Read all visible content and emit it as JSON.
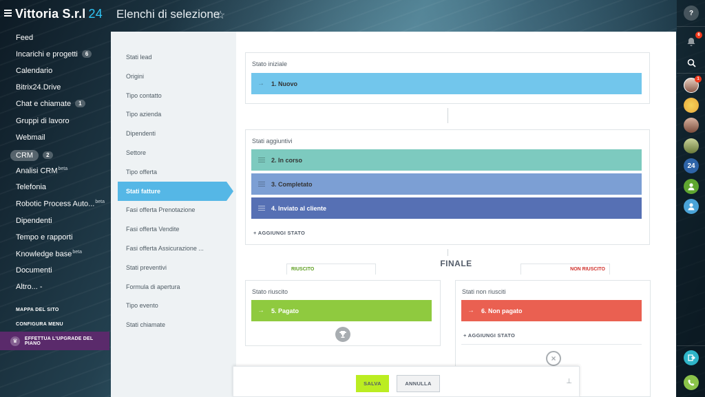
{
  "header": {
    "brand_name": "Vittoria S.r.l",
    "brand_suffix": "24",
    "page_title": "Elenchi di selezione",
    "star_glyph": "☆"
  },
  "left_menu": {
    "items": [
      {
        "label": "Feed"
      },
      {
        "label": "Incarichi e progetti",
        "badge": "6"
      },
      {
        "label": "Calendario"
      },
      {
        "label": "Bitrix24.Drive"
      },
      {
        "label": "Chat e chiamate",
        "badge": "1"
      },
      {
        "label": "Gruppi di lavoro"
      },
      {
        "label": "Webmail"
      },
      {
        "label": "CRM",
        "badge": "2",
        "active": true
      },
      {
        "label": "Analisi CRM",
        "sup": "beta"
      },
      {
        "label": "Telefonia"
      },
      {
        "label": "Robotic Process Auto...",
        "sup": "beta"
      },
      {
        "label": "Dipendenti"
      },
      {
        "label": "Tempo e rapporti"
      },
      {
        "label": "Knowledge base",
        "sup": "beta"
      },
      {
        "label": "Documenti"
      },
      {
        "label": "Altro... -"
      }
    ],
    "site_map": "MAPPA DEL SITO",
    "configure_menu": "CONFIGURA MENU",
    "upgrade": "EFFETTUA L'UPGRADE DEL PIANO"
  },
  "settings_list": {
    "items": [
      "Stati lead",
      "Origini",
      "Tipo contatto",
      "Tipo azienda",
      "Dipendenti",
      "Settore",
      "Tipo offerta",
      "Stati fatture",
      "Fasi offerta Prenotazione",
      "Fasi offerta Vendite",
      "Fasi offerta Assicurazione ...",
      "Stati preventivi",
      "Formula di apertura",
      "Tipo evento",
      "Stati chiamate"
    ],
    "active_index": 7
  },
  "initial": {
    "title": "Stato iniziale",
    "stage": {
      "label": "1. Nuovo",
      "color": "#72c6ec"
    }
  },
  "additional": {
    "title": "Stati aggiuntivi",
    "stages": [
      {
        "label": "2. In corso",
        "color": "#7dcabf"
      },
      {
        "label": "3. Completato",
        "color": "#7c9fd4"
      },
      {
        "label": "4. Inviato al cliente",
        "color": "#5670b4"
      }
    ],
    "add_label": "+ AGGIUNGI STATO"
  },
  "final": {
    "title": "FINALE",
    "success_tab": "RIUSCITO",
    "fail_tab": "NON RIUSCITO",
    "success": {
      "title": "Stato riuscito",
      "stage": {
        "label": "5. Pagato",
        "color": "#8fca3f"
      }
    },
    "fail": {
      "title": "Stati non riusciti",
      "stage": {
        "label": "6. Non pagato",
        "color": "#ea6051"
      },
      "add_label": "+ AGGIUNGI STATO"
    }
  },
  "footer": {
    "save_label": "SALVA",
    "cancel_label": "ANNULLA"
  },
  "right_bar": {
    "help_glyph": "?",
    "notifications_badge": "6",
    "avatar_badge": "1",
    "logo24": "24"
  },
  "colors": {
    "accent": "#55b7e6",
    "success_tab": "#5c9d1f",
    "fail_tab": "#d0302b",
    "upgrade_bg": "#5a2a6b"
  }
}
